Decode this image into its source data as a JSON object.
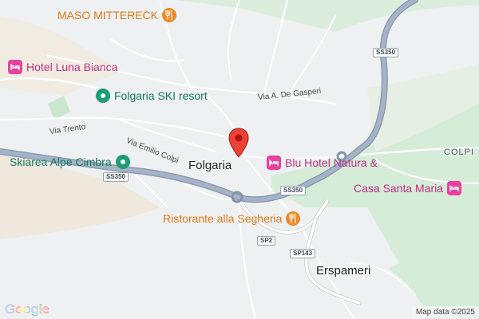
{
  "map": {
    "places": {
      "folgaria": "Folgaria",
      "erspameri": "Erspameri",
      "colpi": "COLPI"
    },
    "pois": {
      "maso_mittereck": "MASO MITTERECK",
      "hotel_luna_bianca": "Hotel Luna Bianca",
      "folgaria_ski_resort": "Folgaria SKI resort",
      "skiarea_alpe_cimbra": "Skiarea Alpe Cimbra",
      "blu_hotel_natura": "Blu Hotel Natura &",
      "casa_santa_maria": "Casa Santa Maria",
      "ristorante_alla_segheria": "Ristorante alla Segheria"
    },
    "roads": {
      "via_de_gasperi": "Via A. De Gasperi",
      "via_trento": "Via Trento",
      "via_emilio_colpi": "Via Emilio Colpi"
    },
    "shields": {
      "ss350_a": "SS350",
      "ss350_b": "SS350",
      "ss350_c": "SS350",
      "sp2": "SP2",
      "sp143": "SP143"
    },
    "attribution": "Map data ©2025",
    "logo": "Google"
  },
  "colors": {
    "lodging": "#e8419d",
    "food": "#f08a24",
    "park": "#1e9c76",
    "green_area": "#d5ecd9",
    "land": "#eef0f1",
    "highway": "#a4b3c7",
    "highway_edge": "#8595ab"
  }
}
